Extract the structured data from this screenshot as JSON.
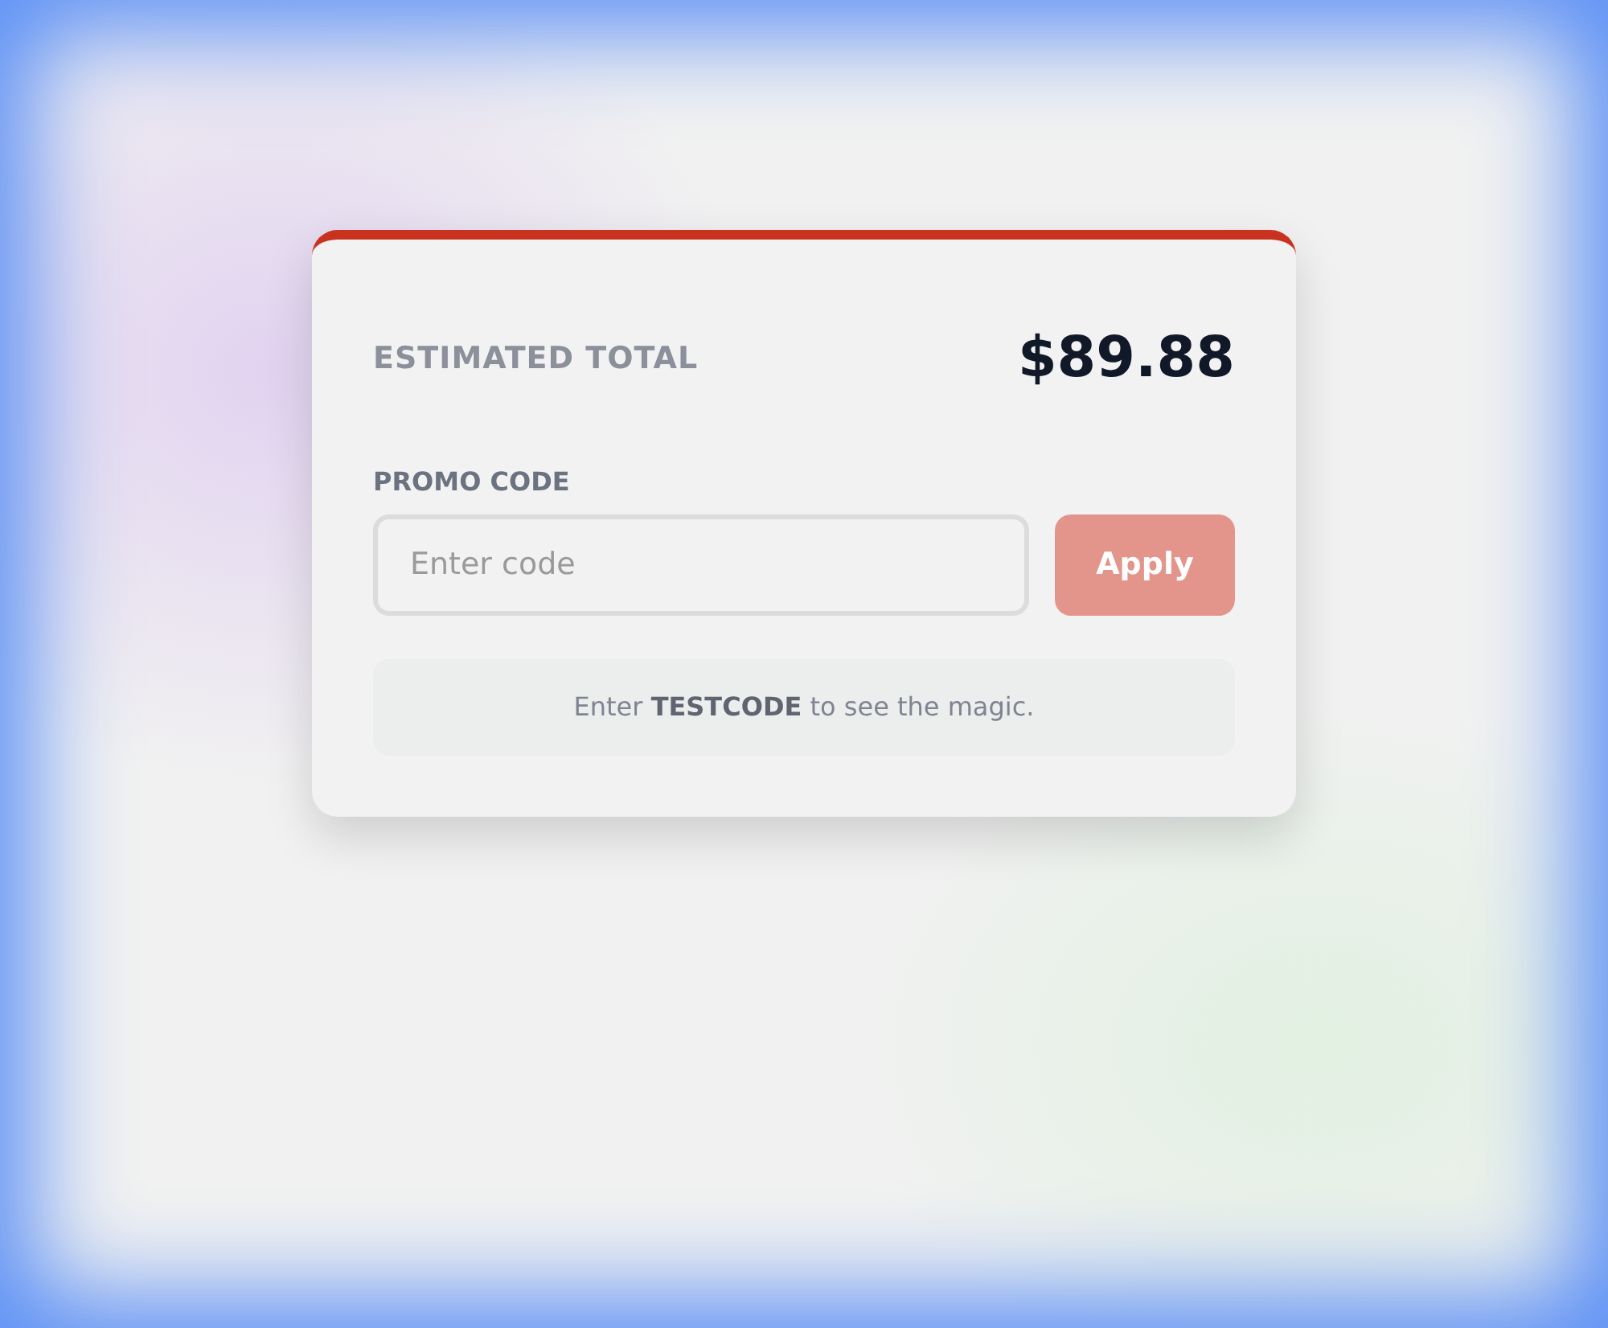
{
  "summary": {
    "label": "ESTIMATED TOTAL",
    "amount": "$89.88"
  },
  "promo": {
    "label": "PROMO CODE",
    "placeholder": "Enter code",
    "apply_button": {
      "label": "Apply",
      "disabled": true
    }
  },
  "hint": "Enter **TESTCODE** to see the magic."
}
